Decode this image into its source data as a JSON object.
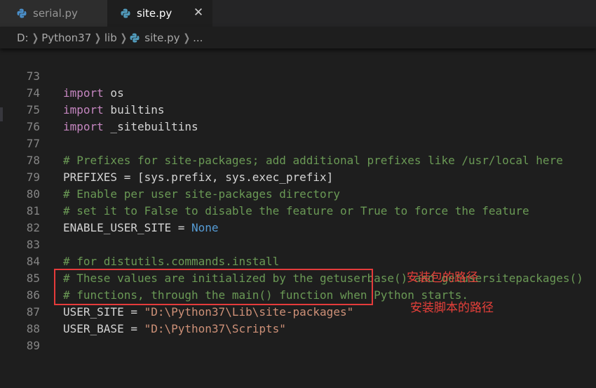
{
  "tabs": [
    {
      "label": "serial.py",
      "icon": "python-file-icon",
      "active": false
    },
    {
      "label": "site.py",
      "icon": "python-file-icon",
      "active": true,
      "close": "✕"
    }
  ],
  "breadcrumb": {
    "drive": "D:",
    "folder1": "Python37",
    "folder2": "lib",
    "file": "site.py",
    "more": "..."
  },
  "editor": {
    "lines": [
      {
        "n": "73",
        "text": "import os"
      },
      {
        "n": "74",
        "text": "import builtins"
      },
      {
        "n": "75",
        "text": "import _sitebuiltins"
      },
      {
        "n": "76",
        "text": ""
      },
      {
        "n": "77",
        "text": "# Prefixes for site-packages; add additional prefixes like /usr/local here"
      },
      {
        "n": "78",
        "text": "PREFIXES = [sys.prefix, sys.exec_prefix]"
      },
      {
        "n": "79",
        "text": "# Enable per user site-packages directory"
      },
      {
        "n": "80",
        "text": "# set it to False to disable the feature or True to force the feature"
      },
      {
        "n": "81",
        "text": "ENABLE_USER_SITE = None"
      },
      {
        "n": "82",
        "text": ""
      },
      {
        "n": "83",
        "text": "# for distutils.commands.install"
      },
      {
        "n": "84",
        "text": "# These values are initialized by the getuserbase() and getusersitepackages()"
      },
      {
        "n": "85",
        "text": "# functions, through the main() function when Python starts."
      },
      {
        "n": "86",
        "text": "USER_SITE = \"D:\\Python37\\Lib\\site-packages\""
      },
      {
        "n": "87",
        "text": "USER_BASE = \"D:\\Python37\\Scripts\""
      },
      {
        "n": "88",
        "text": ""
      },
      {
        "n": "89",
        "text": ""
      }
    ]
  },
  "annotations": {
    "site_packages": "安装包的路径",
    "scripts": "安装脚本的路径"
  },
  "colors": {
    "background": "#1e1e1e",
    "keyword": "#c586c0",
    "comment": "#6a9955",
    "string": "#ce9178",
    "constant": "#569cd6",
    "annotation": "#e8403a"
  }
}
